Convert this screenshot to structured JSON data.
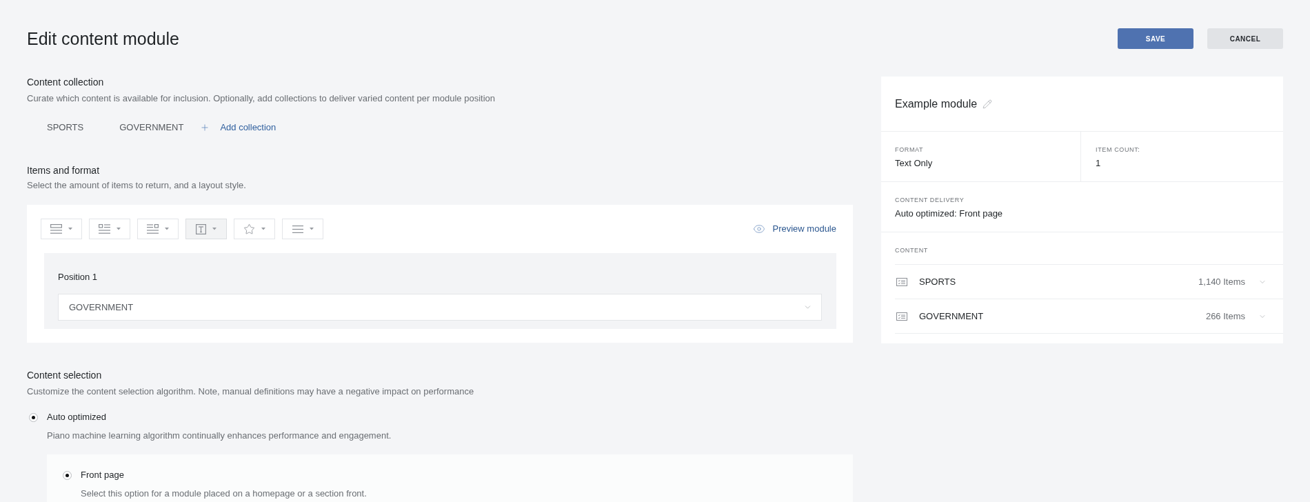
{
  "page": {
    "title": "Edit content module"
  },
  "actions": [
    {
      "label": "SAVE",
      "kind": "primary"
    },
    {
      "label": "CANCEL",
      "kind": "secondary"
    }
  ],
  "content_collection": {
    "heading": "Content collection",
    "description": "Curate which content is available for inclusion. Optionally, add collections to deliver varied content per module position",
    "collections": [
      "SPORTS",
      "GOVERNMENT"
    ],
    "add_link": "Add collection"
  },
  "items_and_format": {
    "heading": "Items and format",
    "description": "Select the amount of items to return, and a layout style.",
    "layout_buttons": [
      {
        "kind": "image-rows",
        "selected": false
      },
      {
        "kind": "thumb-left",
        "selected": false
      },
      {
        "kind": "thumb-right",
        "selected": false
      },
      {
        "kind": "text",
        "selected": true
      },
      {
        "kind": "star",
        "selected": false
      },
      {
        "kind": "lines",
        "selected": false
      }
    ],
    "preview_link": "Preview module",
    "positions": [
      {
        "label": "Position 1",
        "value": "GOVERNMENT"
      }
    ]
  },
  "content_selection": {
    "heading": "Content selection",
    "description": "Customize the content selection algorithm. Note, manual definitions may have a negative impact on performance",
    "options": [
      {
        "label": "Auto optimized",
        "description": "Piano machine learning algorithm continually enhances performance and engagement.",
        "selected": true,
        "children": [
          {
            "label": "Front page",
            "description": "Select this option for a module placed on a homepage or a section front.",
            "selected": true
          }
        ]
      }
    ]
  },
  "summary": {
    "title": "Example module",
    "fields": [
      {
        "label": "FORMAT",
        "value": "Text Only"
      },
      {
        "label": "ITEM COUNT:",
        "value": "1"
      }
    ],
    "delivery": {
      "label": "CONTENT DELIVERY",
      "value": "Auto optimized: Front page"
    },
    "content": {
      "label": "CONTENT",
      "rows": [
        {
          "name": "SPORTS",
          "count": "1,140 Items"
        },
        {
          "name": "GOVERNMENT",
          "count": "266 Items"
        }
      ]
    }
  }
}
